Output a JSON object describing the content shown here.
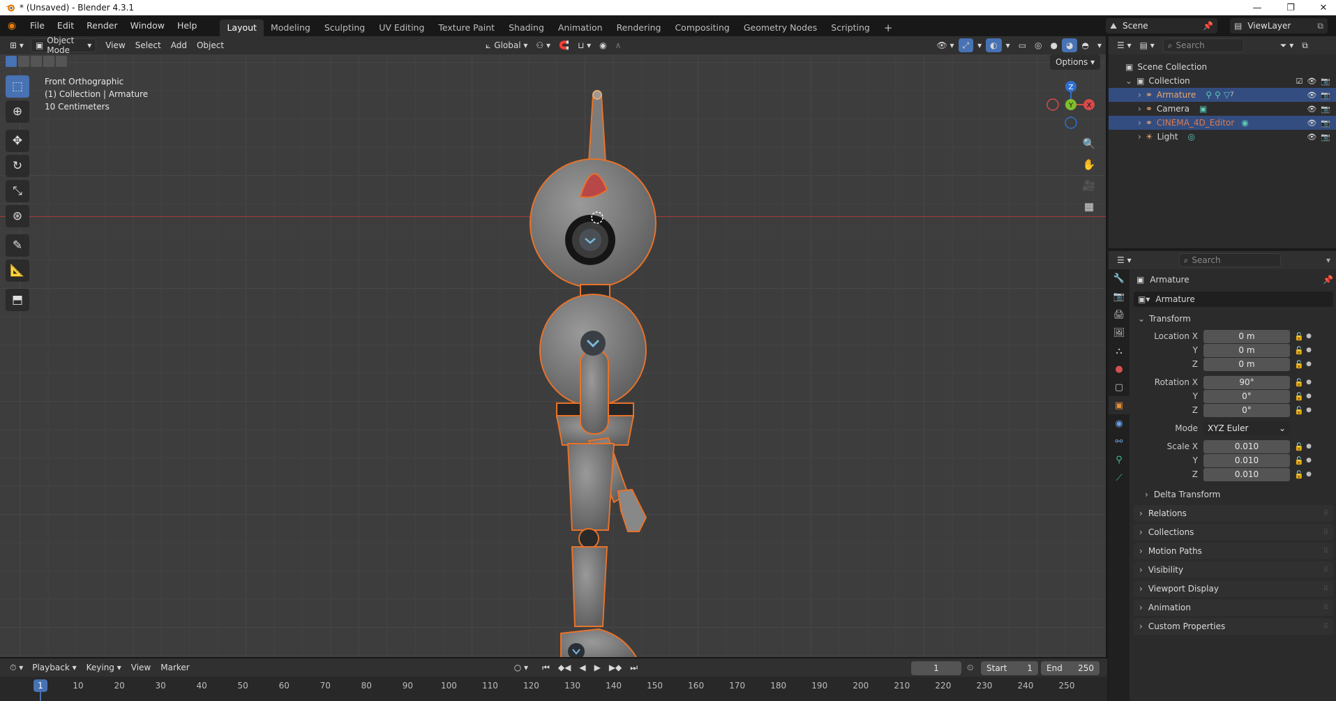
{
  "window": {
    "title": "* (Unsaved) - Blender 4.3.1",
    "controls": [
      "—",
      "❐",
      "✕"
    ]
  },
  "menus": [
    "File",
    "Edit",
    "Render",
    "Window",
    "Help"
  ],
  "workspaces": [
    "Layout",
    "Modeling",
    "Sculpting",
    "UV Editing",
    "Texture Paint",
    "Shading",
    "Animation",
    "Rendering",
    "Compositing",
    "Geometry Nodes",
    "Scripting"
  ],
  "workspace_add": "+",
  "scene": {
    "name": "Scene",
    "view_layer": "ViewLayer"
  },
  "viewport": {
    "mode": "Object Mode",
    "menus": [
      "View",
      "Select",
      "Add",
      "Object"
    ],
    "orientation": "Global",
    "options_label": "Options",
    "info": {
      "view": "Front Orthographic",
      "collection": "(1) Collection | Armature",
      "scale": "10 Centimeters"
    },
    "gizmo": {
      "z": "Z",
      "y": "Y",
      "x": "X"
    }
  },
  "outliner": {
    "search_placeholder": "Search",
    "root": "Scene Collection",
    "collection": "Collection",
    "items": [
      {
        "name": "Armature",
        "selected": true,
        "color": "#e8a66a"
      },
      {
        "name": "Camera",
        "selected": false,
        "color": "#e0e0e0"
      },
      {
        "name": "CINEMA_4D_Editor",
        "selected": true,
        "color": "#e07a4a"
      },
      {
        "name": "Light",
        "selected": false,
        "color": "#e0e0e0"
      }
    ],
    "armature_bone_count": "7"
  },
  "properties": {
    "search_placeholder": "Search",
    "object_name": "Armature",
    "object_field": "Armature",
    "transform_label": "Transform",
    "location": {
      "label": "Location X",
      "x": "0 m",
      "y": "0 m",
      "z": "0 m"
    },
    "rotation": {
      "label": "Rotation X",
      "x": "90°",
      "y": "0°",
      "z": "0°"
    },
    "mode": {
      "label": "Mode",
      "value": "XYZ Euler"
    },
    "scale": {
      "label": "Scale X",
      "x": "0.010",
      "y": "0.010",
      "z": "0.010"
    },
    "axis_labels": {
      "y": "Y",
      "z": "Z"
    },
    "subpanel": "Delta Transform",
    "panels": [
      "Relations",
      "Collections",
      "Motion Paths",
      "Visibility",
      "Viewport Display",
      "Animation",
      "Custom Properties"
    ]
  },
  "timeline": {
    "menus": [
      "Playback",
      "Keying",
      "View",
      "Marker"
    ],
    "current_frame": "1",
    "start_label": "Start",
    "start": "1",
    "end_label": "End",
    "end": "250",
    "ticks": [
      "10",
      "20",
      "30",
      "40",
      "50",
      "60",
      "70",
      "80",
      "90",
      "100",
      "110",
      "120",
      "130",
      "140",
      "150",
      "160",
      "170",
      "180",
      "190",
      "200",
      "210",
      "220",
      "230",
      "240",
      "250"
    ],
    "playhead": "1"
  },
  "colors": {
    "accent": "#4772b3",
    "selection_outline": "#e8722a",
    "axis_x": "#a23b3b"
  }
}
